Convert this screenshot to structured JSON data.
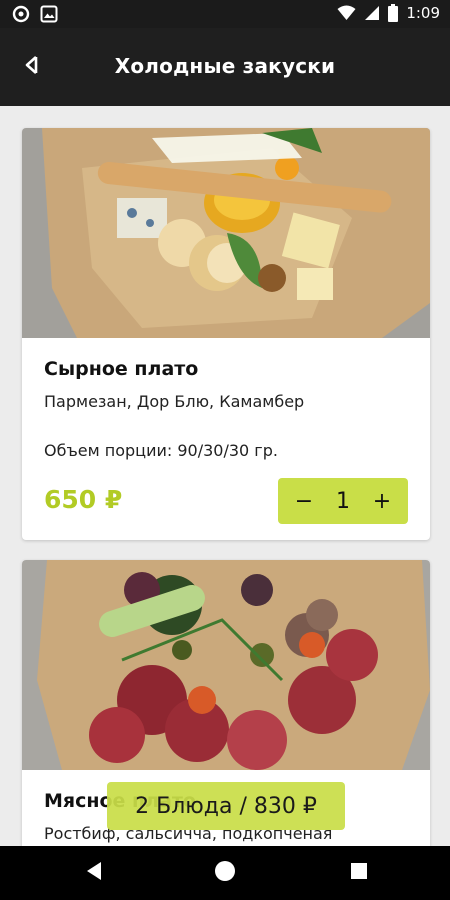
{
  "status_bar": {
    "time": "1:09",
    "icons": [
      "circle-notification-icon",
      "image-notification-icon",
      "wifi-icon",
      "signal-icon",
      "battery-icon"
    ]
  },
  "app_bar": {
    "title": "Холодные закуски",
    "back_icon": "back-arrow-icon"
  },
  "products": [
    {
      "name": "Сырное плато",
      "description": "Пармезан, Дор Блю, Камамбер",
      "portion": "Объем порции: 90/30/30 гр.",
      "price": "650 ₽",
      "quantity": "1",
      "minus_label": "−",
      "plus_label": "+",
      "image": "cheese-platter-photo"
    },
    {
      "name": "Мясное плато",
      "description": "Ростбиф, сальсичча, подкопченая",
      "image": "meat-platter-photo"
    }
  ],
  "cart": {
    "label": "2 Блюда / 830 ₽"
  },
  "colors": {
    "accent": "#c9de48",
    "price": "#b2cb25",
    "app_bar": "#1f1f1f",
    "status_bar": "#1b1b1b",
    "nav_bar": "#000000",
    "background": "#ececec"
  },
  "nav_bar": {
    "icons": [
      "nav-back-icon",
      "nav-home-icon",
      "nav-recents-icon"
    ]
  }
}
